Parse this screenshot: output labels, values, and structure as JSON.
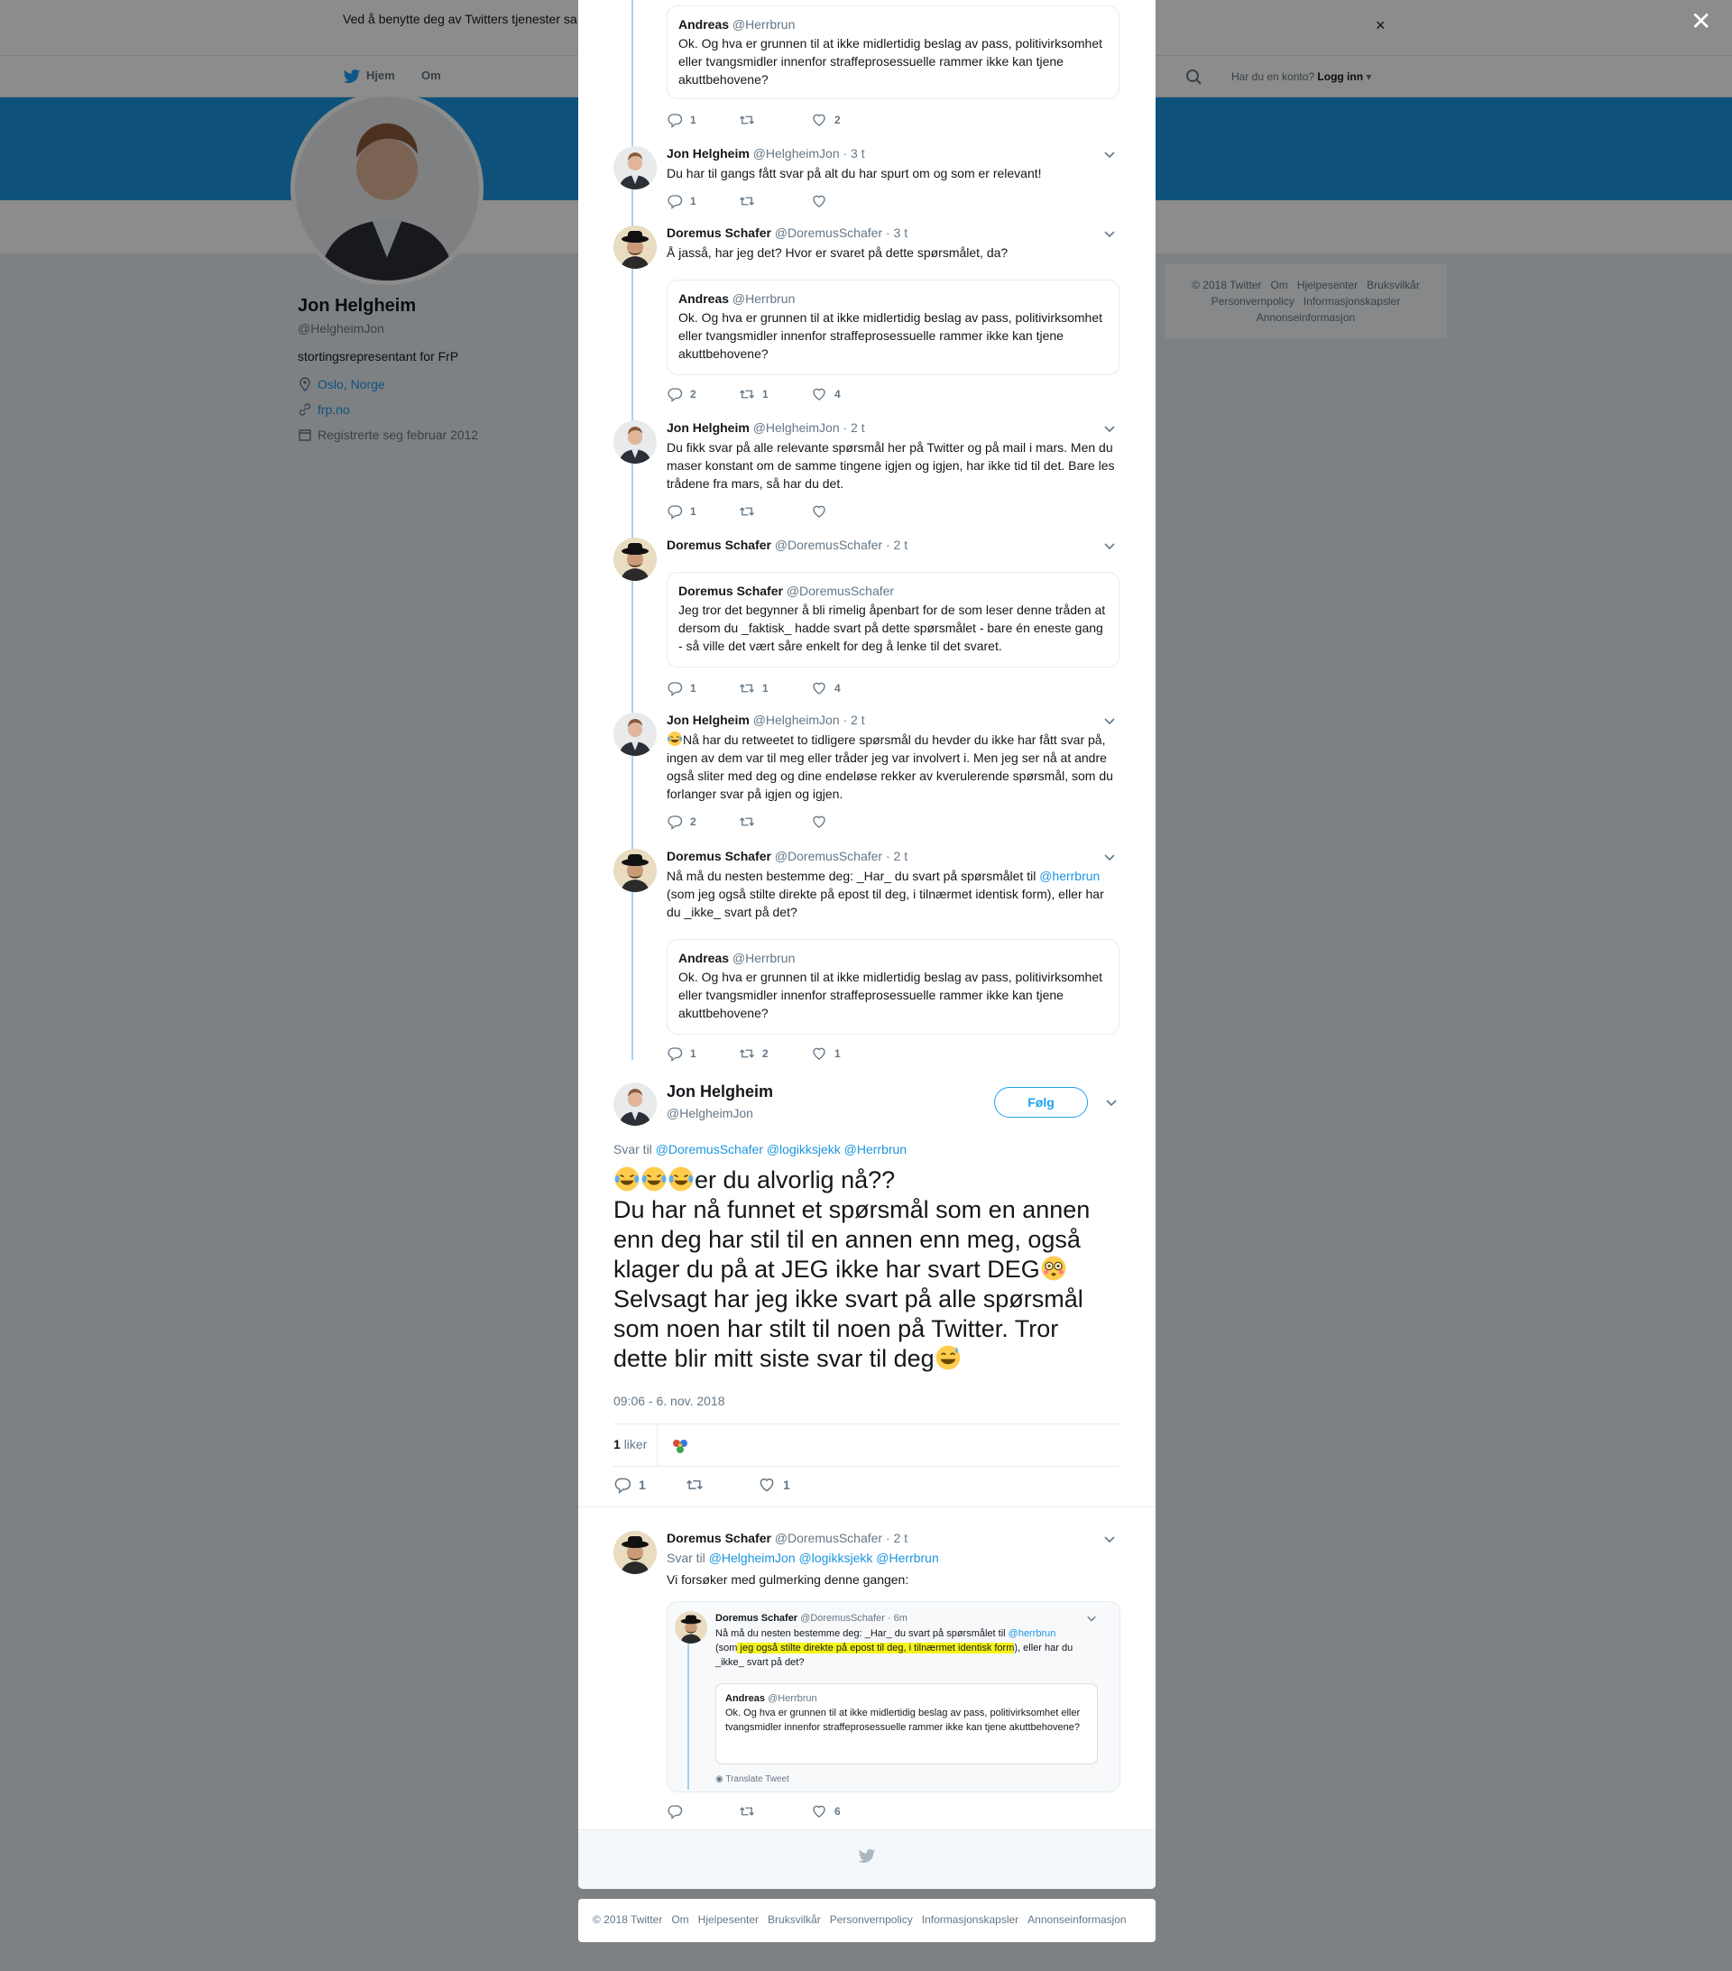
{
  "cookie_banner": {
    "text": "Ved å benytte deg av Twitters tjenester sa                                                                            informasjonskapsler til bl.a. analyser, personalisering og annonser.",
    "close_icon": "×"
  },
  "nav": {
    "home": "Hjem",
    "about": "Om",
    "have_account": "Har du en konto?",
    "login": "Logg inn"
  },
  "profile": {
    "name": "Jon Helgheim",
    "handle": "@HelgheimJon",
    "bio": "stortingsrepresentant for FrP",
    "location": "Oslo, Norge",
    "url": "frp.no",
    "joined": "Registrerte seg februar 2012"
  },
  "right_footer": {
    "items": [
      "© 2018 Twitter",
      "Om",
      "Hjelpesenter",
      "Bruksvilkår",
      "Personvernpolicy",
      "Informasjonskapsler",
      "Annonseinformasjon"
    ]
  },
  "modal_close": "✕",
  "thread": [
    {
      "quote": {
        "name": "Andreas",
        "handle": "@Herrbrun",
        "text": "Ok. Og hva er grunnen til at ikke midlertidig beslag av pass, politivirksomhet eller tvangsmidler innenfor straffeprosessuelle rammer ikke kan tjene akuttbehovene?"
      },
      "replies": "1",
      "retweets": "",
      "likes": "2"
    },
    {
      "name": "Jon Helgheim",
      "handle": "@HelgheimJon",
      "time": "· 3 t",
      "text": "Du har til gangs fått svar på alt du har spurt om og som er relevant!",
      "replies": "1",
      "retweets": "",
      "likes": ""
    },
    {
      "name": "Doremus Schafer",
      "handle": "@DoremusSchafer",
      "time": "· 3 t",
      "text": "Å jasså, har jeg det? Hvor er svaret på dette spørsmålet, da?",
      "quote": {
        "name": "Andreas",
        "handle": "@Herrbrun",
        "text": "Ok. Og hva er grunnen til at ikke midlertidig beslag av pass, politivirksomhet eller tvangsmidler innenfor straffeprosessuelle rammer ikke kan tjene akuttbehovene?"
      },
      "replies": "2",
      "retweets": "1",
      "likes": "4"
    },
    {
      "name": "Jon Helgheim",
      "handle": "@HelgheimJon",
      "time": "· 2 t",
      "text": "Du fikk svar på alle relevante spørsmål her på Twitter og på mail i mars. Men du maser konstant om de samme tingene igjen og igjen, har ikke tid til det. Bare les trådene fra mars, så har du det.",
      "replies": "1",
      "retweets": "",
      "likes": ""
    },
    {
      "name": "Doremus Schafer",
      "handle": "@DoremusSchafer",
      "time": "· 2 t",
      "text": "",
      "quote": {
        "name": "Doremus Schafer",
        "handle": "@DoremusSchafer",
        "text": "Jeg tror det begynner å bli rimelig åpenbart for de som leser denne tråden at dersom du _faktisk_ hadde svart på dette spørsmålet - bare én eneste gang - så ville det vært såre enkelt for deg å lenke til det svaret."
      },
      "replies": "1",
      "retweets": "1",
      "likes": "4"
    },
    {
      "name": "Jon Helgheim",
      "handle": "@HelgheimJon",
      "time": "· 2 t",
      "text": "Nå har du retweetet to tidligere spørsmål du hevder du ikke har fått svar på, ingen av dem var til meg eller tråder jeg var involvert i. Men jeg ser nå at andre også sliter med deg og dine endeløse rekker av kverulerende spørsmål, som du forlanger svar på igjen og igjen.",
      "replies": "2",
      "retweets": "",
      "likes": ""
    },
    {
      "name": "Doremus Schafer",
      "handle": "@DoremusSchafer",
      "time": "· 2 t",
      "text_a": "Nå må du nesten bestemme deg: _Har_ du svart på spørsmålet til ",
      "mention": "@herrbrun",
      "text_b": " (som jeg også stilte direkte på epost til deg, i tilnærmet identisk form), eller har du _ikke_ svart på det?",
      "quote": {
        "name": "Andreas",
        "handle": "@Herrbrun",
        "text": "Ok. Og hva er grunnen til at ikke midlertidig beslag av pass, politivirksomhet eller tvangsmidler innenfor straffeprosessuelle rammer ikke kan tjene akuttbehovene?"
      },
      "replies": "1",
      "retweets": "2",
      "likes": "1"
    }
  ],
  "main_tweet": {
    "name": "Jon Helgheim",
    "handle": "@HelgheimJon",
    "follow": "Følg",
    "replying_label": "Svar til",
    "replying_to": [
      "@DoremusSchafer",
      "@logikksjekk",
      "@Herrbrun"
    ],
    "line1": "er du alvorlig nå??",
    "line2": "Du har nå funnet et spørsmål som en annen enn deg har stil til en annen enn meg, også klager du på at JEG ikke har svart DEG",
    "line3": "Selvsagt har jeg ikke svart på alle spørsmål som noen har stilt til noen på Twitter. Tror dette blir mitt siste svar til deg",
    "time": "09:06 - 6. nov. 2018",
    "likes_count": "1",
    "likes_label": "liker",
    "replies": "1",
    "retweets": "",
    "likes": "1"
  },
  "reply_tweet": {
    "name": "Doremus Schafer",
    "handle": "@DoremusSchafer",
    "time": "· 2 t",
    "replying_label": "Svar til",
    "replying_to": [
      "@HelgheimJon",
      "@logikksjekk",
      "@Herrbrun"
    ],
    "text": "Vi forsøker med gulmerking denne gangen:",
    "replies": "",
    "retweets": "",
    "likes": "6",
    "screenshot": {
      "name": "Doremus Schafer",
      "handle": "@DoremusSchafer · 6m",
      "text_a": "Nå må du nesten bestemme deg: _Har_ du svart på spørsmålet til ",
      "mention": "@herrbrun",
      "text_b": "(som",
      "highlight": " jeg også stilte direkte på epost til deg, i tilnærmet identisk form",
      "text_c": "), eller har du _ikke_ svart på det?",
      "quote_name": "Andreas",
      "quote_handle": "@Herrbrun",
      "quote_text": "Ok. Og hva er grunnen til at ikke midlertidig beslag av pass, politivirksomhet eller tvangsmidler innenfor straffeprosessuelle rammer ikke kan tjene akuttbehovene?",
      "translate": "Translate Tweet"
    }
  },
  "bottom_footer": {
    "items": [
      "© 2018 Twitter",
      "Om",
      "Hjelpesenter",
      "Bruksvilkår",
      "Personvernpolicy",
      "Informasjonskapsler",
      "Annonseinformasjon"
    ]
  },
  "colors": {
    "accent": "#1b95e0",
    "banner": "#1b95e0",
    "highlight": "#f7f51a",
    "thread_line": "#a6d2f1"
  }
}
